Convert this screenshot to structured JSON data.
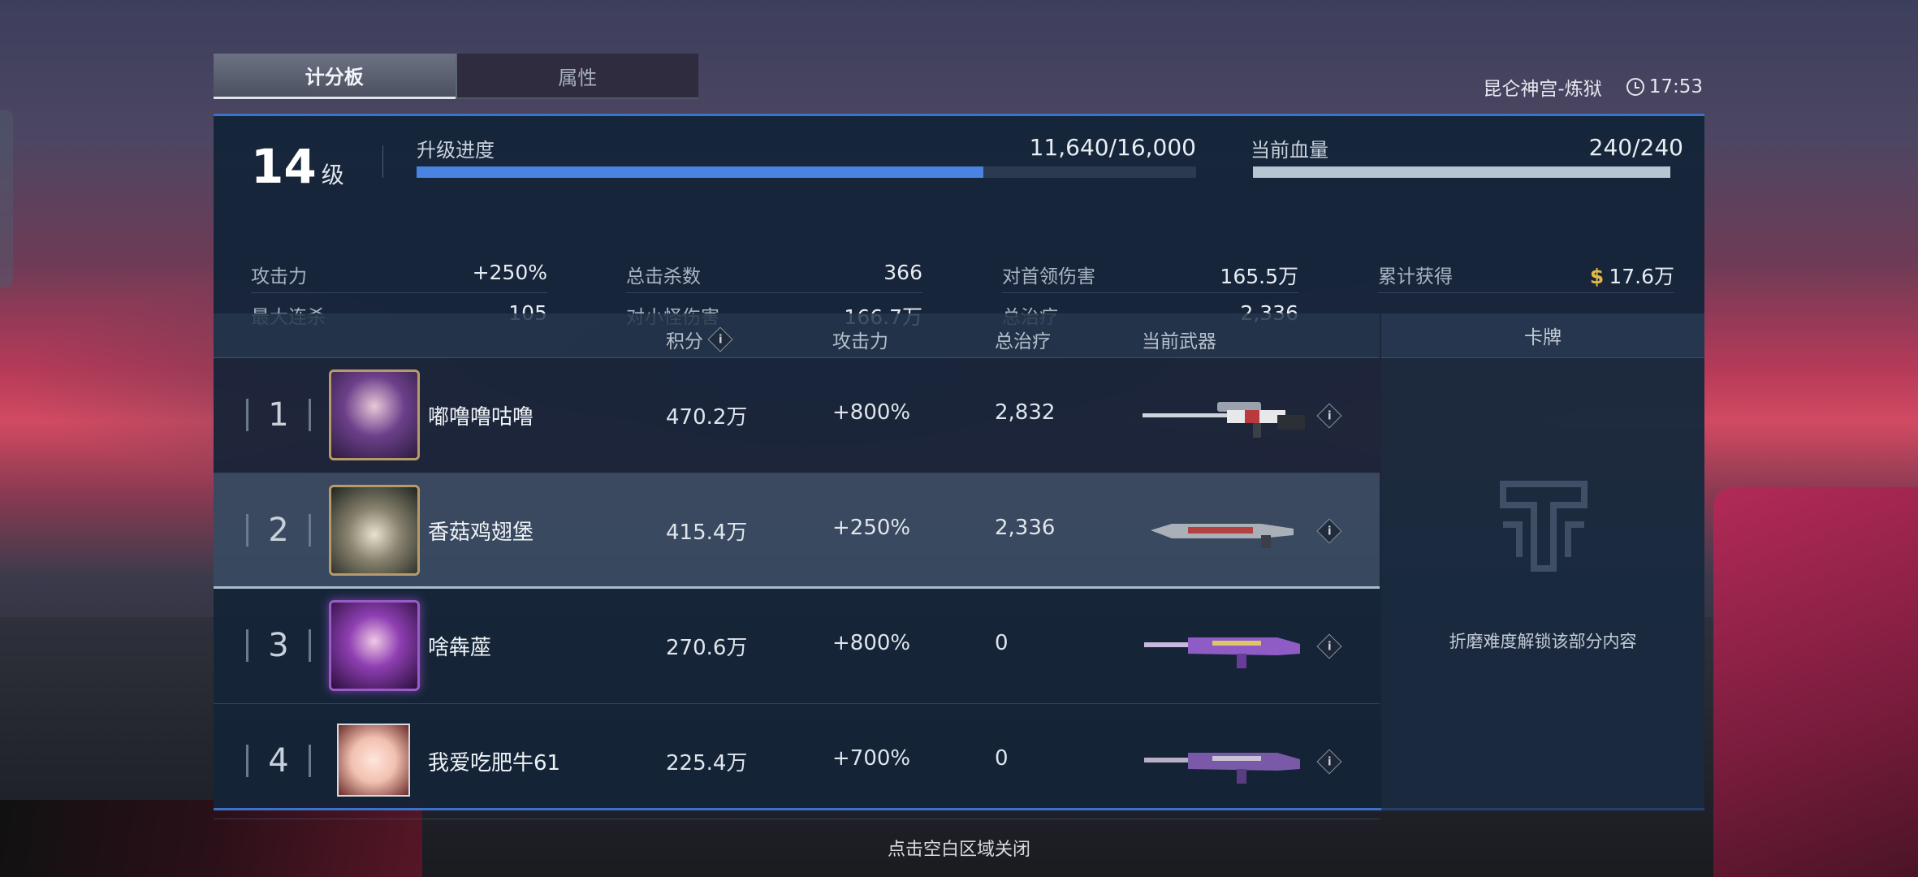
{
  "tabs": [
    {
      "label": "计分板",
      "active": true
    },
    {
      "label": "属性",
      "active": false
    }
  ],
  "map_name": "昆仑神宫-炼狱",
  "time": "17:53",
  "summary": {
    "level_number": "14",
    "level_unit": "级",
    "progress_label": "升级进度",
    "progress_text": "11,640/16,000",
    "progress_fraction": 0.7275,
    "hp_label": "当前血量",
    "hp_text": "240/240",
    "hp_fraction": 1.0,
    "stats": [
      {
        "label": "攻击力",
        "value": "+250%"
      },
      {
        "label": "总击杀数",
        "value": "366"
      },
      {
        "label": "对首领伤害",
        "value": "165.5万"
      },
      {
        "label": "累计获得",
        "value": "17.6万",
        "currency": "$"
      },
      {
        "label": "最大连杀",
        "value": "105"
      },
      {
        "label": "对小怪伤害",
        "value": "166.7万"
      },
      {
        "label": "总治疗",
        "value": "2,336"
      }
    ]
  },
  "table": {
    "headers": {
      "score": "积分",
      "attack": "攻击力",
      "healing": "总治疗",
      "weapon": "当前武器",
      "cards": "卡牌"
    },
    "players": [
      {
        "rank": "1",
        "name": "嘟噜噜咕噜",
        "score": "470.2万",
        "attack": "+800%",
        "healing": "2,832"
      },
      {
        "rank": "2",
        "name": "香菇鸡翅堡",
        "score": "415.4万",
        "attack": "+250%",
        "healing": "2,336"
      },
      {
        "rank": "3",
        "name": "啥犇蓙",
        "score": "270.6万",
        "attack": "+800%",
        "healing": "0"
      },
      {
        "rank": "4",
        "name": "我爱吃肥牛61",
        "score": "225.4万",
        "attack": "+700%",
        "healing": "0"
      }
    ]
  },
  "cards": {
    "locked_text": "折磨难度解锁该部分内容"
  },
  "close_hint": "点击空白区域关闭",
  "icons": {
    "info": "i"
  },
  "colors": {
    "progress": "#4a84e2",
    "hp": "#b7c6d2",
    "accent_border": "#3d72c9",
    "gold": "#e2b84a"
  }
}
